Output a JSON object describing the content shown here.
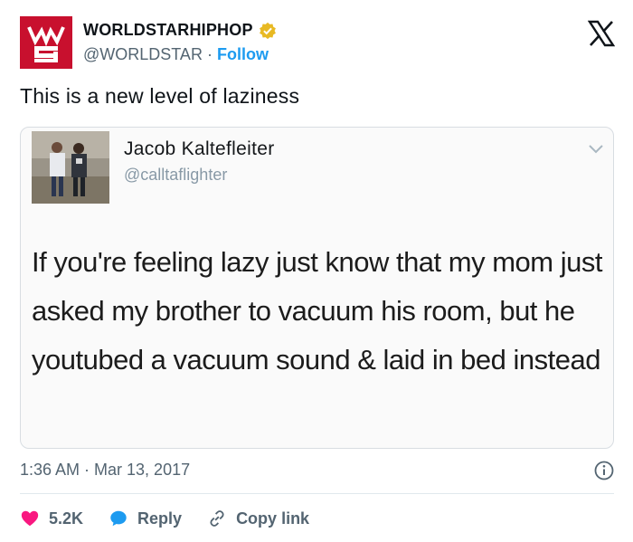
{
  "tweet": {
    "display_name": "WORLDSTARHIPHOP",
    "handle": "@WORLDSTAR",
    "separator": "·",
    "follow_label": "Follow",
    "text": "This is a new level of laziness",
    "timestamp": "1:36 AM · Mar 13, 2017",
    "brand_color": "#c8102e",
    "verified_color": "#e8b923",
    "link_color": "#1d9bf0"
  },
  "quoted": {
    "name": "Jacob Kaltefleiter",
    "handle": "@calltaflighter",
    "body": "If you're feeling lazy just know that my mom just asked my brother to vacuum his room, but he youtubed a vacuum sound & laid in bed instead"
  },
  "actions": {
    "likes": "5.2K",
    "reply_label": "Reply",
    "copy_label": "Copy link",
    "like_color": "#f91880",
    "reply_color": "#1d9bf0"
  },
  "icons": {
    "brand": "x-logo-icon",
    "verified": "verified-badge-icon",
    "info": "info-icon",
    "like": "heart-icon",
    "reply": "speech-bubble-icon",
    "copy": "link-icon",
    "menu": "chevron-down-icon"
  }
}
